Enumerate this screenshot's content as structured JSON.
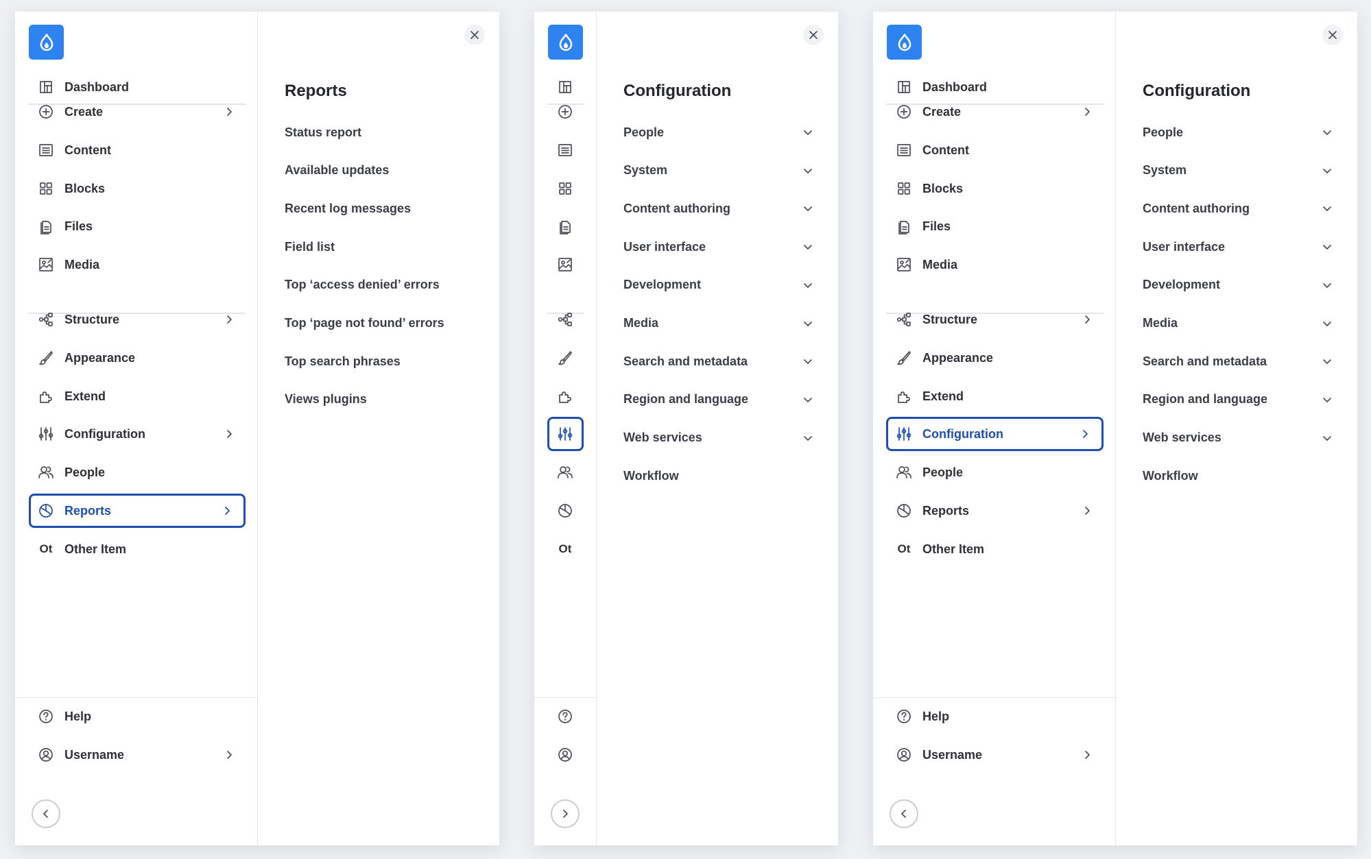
{
  "panels": [
    {
      "sidebar": {
        "collapsed": false,
        "dashboard": "Dashboard",
        "items": [
          {
            "label": "Create",
            "icon": "plus-circle-icon",
            "chevron": true,
            "active": false
          },
          {
            "label": "Content",
            "icon": "content-icon",
            "chevron": false,
            "active": false
          },
          {
            "label": "Blocks",
            "icon": "blocks-icon",
            "chevron": false,
            "active": false
          },
          {
            "label": "Files",
            "icon": "files-icon",
            "chevron": false,
            "active": false
          },
          {
            "label": "Media",
            "icon": "media-icon",
            "chevron": false,
            "active": false
          },
          {
            "label": "Structure",
            "icon": "structure-icon",
            "chevron": true,
            "active": false
          },
          {
            "label": "Appearance",
            "icon": "brush-icon",
            "chevron": false,
            "active": false
          },
          {
            "label": "Extend",
            "icon": "puzzle-icon",
            "chevron": false,
            "active": false
          },
          {
            "label": "Configuration",
            "icon": "sliders-icon",
            "chevron": true,
            "active": false
          },
          {
            "label": "People",
            "icon": "people-icon",
            "chevron": false,
            "active": false
          },
          {
            "label": "Reports",
            "icon": "reports-icon",
            "chevron": true,
            "active": true
          },
          {
            "label": "Other Item",
            "icon": "ot",
            "chevron": false,
            "active": false
          }
        ],
        "other_abbrev": "Ot",
        "help": "Help",
        "username": "Username"
      },
      "submenu": {
        "title": "Reports",
        "items": [
          {
            "label": "Status report",
            "chevron": false
          },
          {
            "label": "Available updates",
            "chevron": false
          },
          {
            "label": "Recent log messages",
            "chevron": false
          },
          {
            "label": "Field list",
            "chevron": false
          },
          {
            "label": "Top ‘access denied’ errors",
            "chevron": false
          },
          {
            "label": "Top ‘page not found’ errors",
            "chevron": false
          },
          {
            "label": "Top search phrases",
            "chevron": false
          },
          {
            "label": "Views plugins",
            "chevron": false
          }
        ]
      }
    },
    {
      "sidebar": {
        "collapsed": true,
        "dashboard": "Dashboard",
        "items": [
          {
            "label": "Create",
            "icon": "plus-circle-icon",
            "chevron": true,
            "active": false
          },
          {
            "label": "Content",
            "icon": "content-icon",
            "chevron": false,
            "active": false
          },
          {
            "label": "Blocks",
            "icon": "blocks-icon",
            "chevron": false,
            "active": false
          },
          {
            "label": "Files",
            "icon": "files-icon",
            "chevron": false,
            "active": false
          },
          {
            "label": "Media",
            "icon": "media-icon",
            "chevron": false,
            "active": false
          },
          {
            "label": "Structure",
            "icon": "structure-icon",
            "chevron": true,
            "active": false
          },
          {
            "label": "Appearance",
            "icon": "brush-icon",
            "chevron": false,
            "active": false
          },
          {
            "label": "Extend",
            "icon": "puzzle-icon",
            "chevron": false,
            "active": false
          },
          {
            "label": "Configuration",
            "icon": "sliders-icon",
            "chevron": true,
            "active": true
          },
          {
            "label": "People",
            "icon": "people-icon",
            "chevron": false,
            "active": false
          },
          {
            "label": "Reports",
            "icon": "reports-icon",
            "chevron": true,
            "active": false
          },
          {
            "label": "Other Item",
            "icon": "ot",
            "chevron": false,
            "active": false
          }
        ],
        "other_abbrev": "Ot",
        "help": "Help",
        "username": "Username"
      },
      "submenu": {
        "title": "Configuration",
        "items": [
          {
            "label": "People",
            "chevron": true
          },
          {
            "label": "System",
            "chevron": true
          },
          {
            "label": "Content authoring",
            "chevron": true
          },
          {
            "label": "User interface",
            "chevron": true
          },
          {
            "label": "Development",
            "chevron": true
          },
          {
            "label": "Media",
            "chevron": true
          },
          {
            "label": "Search and metadata",
            "chevron": true
          },
          {
            "label": "Region and language",
            "chevron": true
          },
          {
            "label": "Web services",
            "chevron": true
          },
          {
            "label": "Workflow",
            "chevron": false
          }
        ]
      }
    },
    {
      "sidebar": {
        "collapsed": false,
        "dashboard": "Dashboard",
        "items": [
          {
            "label": "Create",
            "icon": "plus-circle-icon",
            "chevron": true,
            "active": false
          },
          {
            "label": "Content",
            "icon": "content-icon",
            "chevron": false,
            "active": false
          },
          {
            "label": "Blocks",
            "icon": "blocks-icon",
            "chevron": false,
            "active": false
          },
          {
            "label": "Files",
            "icon": "files-icon",
            "chevron": false,
            "active": false
          },
          {
            "label": "Media",
            "icon": "media-icon",
            "chevron": false,
            "active": false
          },
          {
            "label": "Structure",
            "icon": "structure-icon",
            "chevron": true,
            "active": false
          },
          {
            "label": "Appearance",
            "icon": "brush-icon",
            "chevron": false,
            "active": false
          },
          {
            "label": "Extend",
            "icon": "puzzle-icon",
            "chevron": false,
            "active": false
          },
          {
            "label": "Configuration",
            "icon": "sliders-icon",
            "chevron": true,
            "active": true
          },
          {
            "label": "People",
            "icon": "people-icon",
            "chevron": false,
            "active": false
          },
          {
            "label": "Reports",
            "icon": "reports-icon",
            "chevron": true,
            "active": false
          },
          {
            "label": "Other Item",
            "icon": "ot",
            "chevron": false,
            "active": false
          }
        ],
        "other_abbrev": "Ot",
        "help": "Help",
        "username": "Username"
      },
      "submenu": {
        "title": "Configuration",
        "items": [
          {
            "label": "People",
            "chevron": true
          },
          {
            "label": "System",
            "chevron": true
          },
          {
            "label": "Content authoring",
            "chevron": true
          },
          {
            "label": "User interface",
            "chevron": true
          },
          {
            "label": "Development",
            "chevron": true
          },
          {
            "label": "Media",
            "chevron": true
          },
          {
            "label": "Search and metadata",
            "chevron": true
          },
          {
            "label": "Region and language",
            "chevron": true
          },
          {
            "label": "Web services",
            "chevron": true
          },
          {
            "label": "Workflow",
            "chevron": false
          }
        ]
      }
    }
  ],
  "colors": {
    "brand": "#2f83f0",
    "active": "#1f4fae",
    "background": "#eef0f4"
  }
}
